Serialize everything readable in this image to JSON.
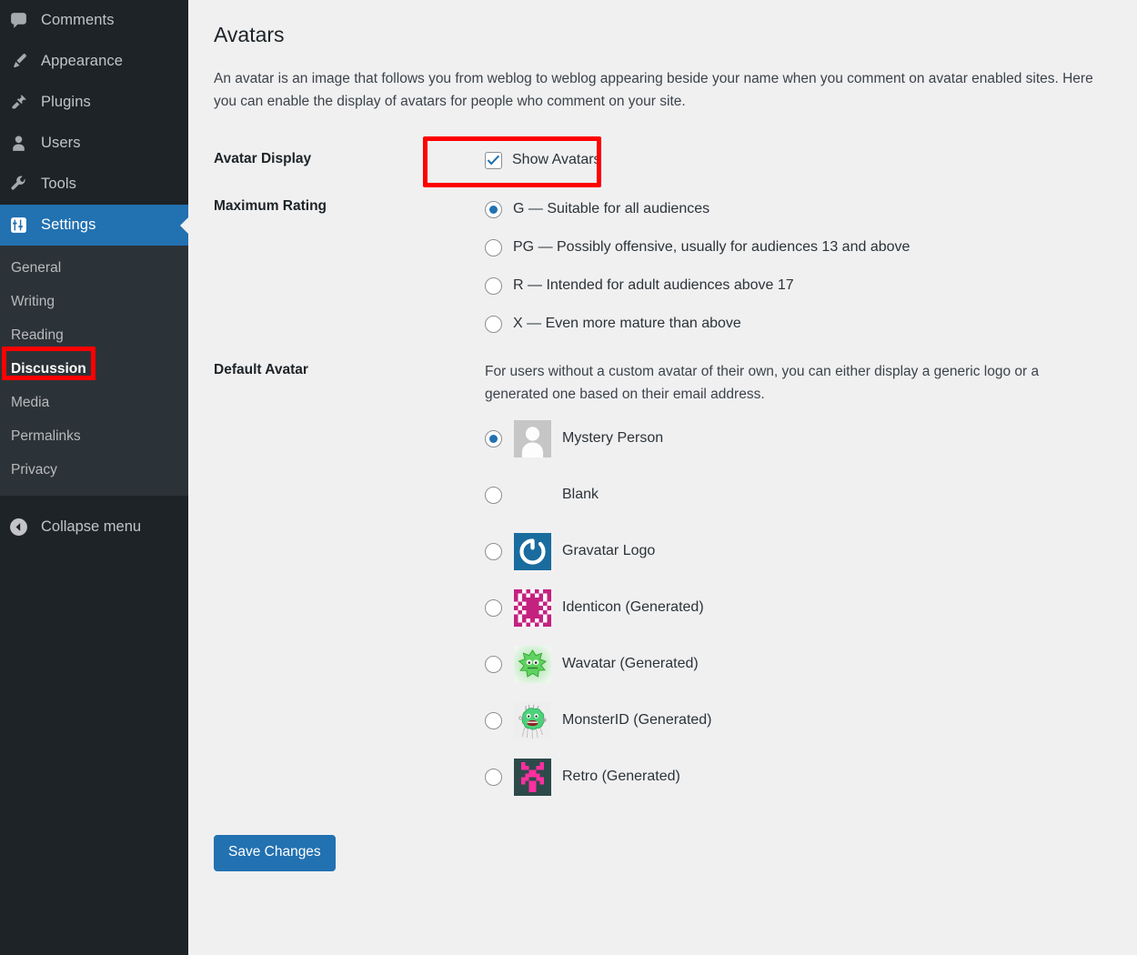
{
  "sidebar": {
    "menu": [
      {
        "label": "Comments",
        "icon": "comment-bubble-icon",
        "current": false
      },
      {
        "label": "Appearance",
        "icon": "paintbrush-icon",
        "current": false
      },
      {
        "label": "Plugins",
        "icon": "plug-icon",
        "current": false
      },
      {
        "label": "Users",
        "icon": "user-icon",
        "current": false
      },
      {
        "label": "Tools",
        "icon": "wrench-icon",
        "current": false
      },
      {
        "label": "Settings",
        "icon": "sliders-icon",
        "current": true
      }
    ],
    "submenu": [
      {
        "label": "General",
        "active": false
      },
      {
        "label": "Writing",
        "active": false
      },
      {
        "label": "Reading",
        "active": false
      },
      {
        "label": "Discussion",
        "active": true
      },
      {
        "label": "Media",
        "active": false
      },
      {
        "label": "Permalinks",
        "active": false
      },
      {
        "label": "Privacy",
        "active": false
      }
    ],
    "collapse": {
      "label": "Collapse menu",
      "icon": "collapse-arrow-icon"
    }
  },
  "main": {
    "title": "Avatars",
    "description": "An avatar is an image that follows you from weblog to weblog appearing beside your name when you comment on avatar enabled sites. Here you can enable the display of avatars for people who comment on your site.",
    "avatar_display": {
      "label": "Avatar Display",
      "checkbox_label": "Show Avatars",
      "checked": true
    },
    "maximum_rating": {
      "label": "Maximum Rating",
      "selected": "G",
      "options": [
        {
          "value": "G",
          "label": "G — Suitable for all audiences",
          "selected": true
        },
        {
          "value": "PG",
          "label": "PG — Possibly offensive, usually for audiences 13 and above",
          "selected": false
        },
        {
          "value": "R",
          "label": "R — Intended for adult audiences above 17",
          "selected": false
        },
        {
          "value": "X",
          "label": "X — Even more mature than above",
          "selected": false
        }
      ]
    },
    "default_avatar": {
      "label": "Default Avatar",
      "description": "For users without a custom avatar of their own, you can either display a generic logo or a generated one based on their email address.",
      "selected": "mystery",
      "options": [
        {
          "value": "mystery",
          "label": "Mystery Person",
          "icon": "mystery-person-avatar-icon",
          "selected": true
        },
        {
          "value": "blank",
          "label": "Blank",
          "icon": "blank-avatar-icon",
          "selected": false
        },
        {
          "value": "gravatar",
          "label": "Gravatar Logo",
          "icon": "gravatar-logo-icon",
          "selected": false
        },
        {
          "value": "identicon",
          "label": "Identicon (Generated)",
          "icon": "identicon-avatar-icon",
          "selected": false
        },
        {
          "value": "wavatar",
          "label": "Wavatar (Generated)",
          "icon": "wavatar-avatar-icon",
          "selected": false
        },
        {
          "value": "monsterid",
          "label": "MonsterID (Generated)",
          "icon": "monsterid-avatar-icon",
          "selected": false
        },
        {
          "value": "retro",
          "label": "Retro (Generated)",
          "icon": "retro-avatar-icon",
          "selected": false
        }
      ]
    },
    "save_button": "Save Changes"
  },
  "colors": {
    "sidebar_bg": "#1d2327",
    "submenu_bg": "#2c3338",
    "accent_blue": "#2271b1",
    "content_bg": "#f0f0f1",
    "highlight_red": "#ff0000"
  }
}
